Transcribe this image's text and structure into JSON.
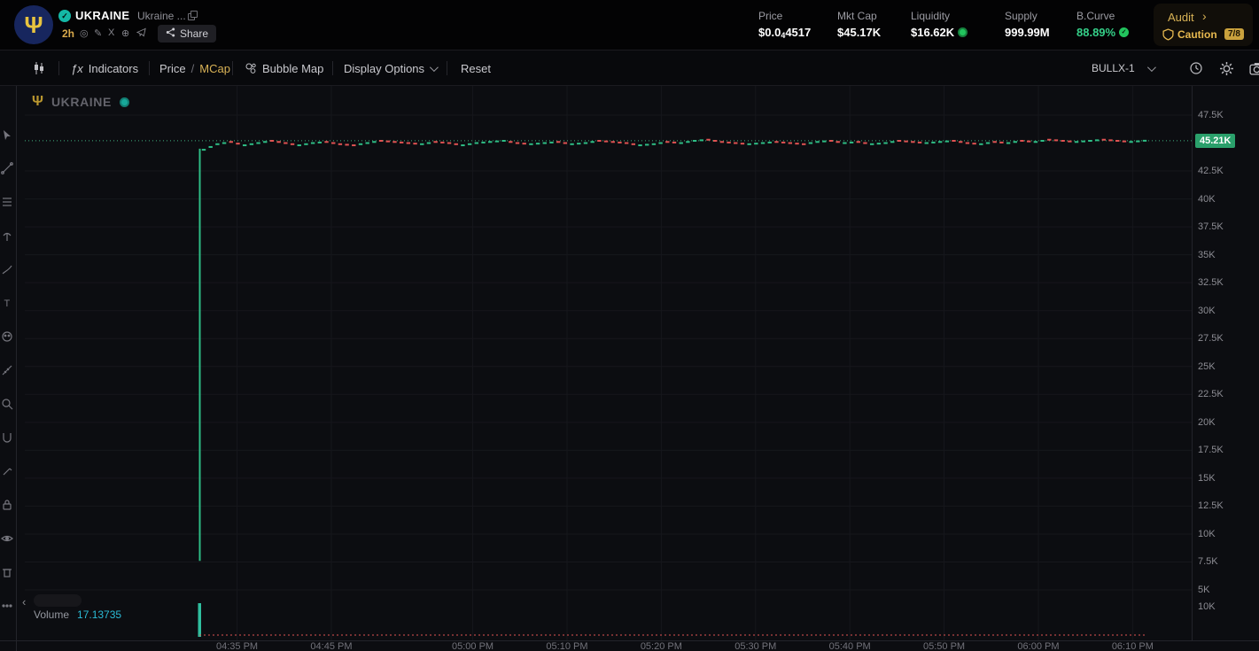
{
  "header": {
    "token": {
      "symbol": "UKRAINE",
      "name": "Ukraine ...",
      "age": "2h",
      "share_label": "Share"
    },
    "stats": {
      "price": {
        "label": "Price",
        "prefix": "$0.0",
        "subscript": "4",
        "suffix": "4517"
      },
      "mkt_cap": {
        "label": "Mkt Cap",
        "value": "$45.17K"
      },
      "liquidity": {
        "label": "Liquidity",
        "value": "$16.62K"
      },
      "supply": {
        "label": "Supply",
        "value": "999.99M"
      },
      "bcurve": {
        "label": "B.Curve",
        "value": "88.89%"
      }
    },
    "audit": {
      "label": "Audit",
      "status": "Caution",
      "score": "7/8"
    }
  },
  "toolbar": {
    "indicators_label": "Indicators",
    "price_label": "Price",
    "separator": "/",
    "mcap_label": "MCap",
    "bubble_map_label": "Bubble Map",
    "display_options_label": "Display Options",
    "reset_label": "Reset",
    "layout_label": "BULLX-1"
  },
  "sidebar": {
    "tools": [
      "cursor",
      "trend-line",
      "fib-retracement",
      "pitchfork",
      "brush",
      "text",
      "emoji",
      "measure",
      "zoom",
      "magnet",
      "edit",
      "lock",
      "eye",
      "remove",
      "more"
    ]
  },
  "chart": {
    "watermark_symbol": "UKRAINE",
    "volume_label": "Volume",
    "volume_value": "17.13735",
    "price_badge": "45.21K",
    "volume_axis_label": "10K"
  },
  "icons": {
    "logo_trident": "Ψ",
    "watermark_trident": "Ψ",
    "verified_check": "✓",
    "pump": "◎",
    "edit": "✎",
    "x_social": "X",
    "globe": "⊕",
    "audit_chevron": "›",
    "collapse": "‹",
    "fx": "ƒx"
  },
  "colors": {
    "up": "#2ebd85",
    "down": "#e05252",
    "grid": "#16171c",
    "divider": "#23242a",
    "gold": "#d8b256",
    "teal_bar": "#2fbf9f",
    "badge_green": "#2aa06b",
    "dotted_price": "#3fae7f"
  },
  "chart_data": {
    "type": "candlestick",
    "title": "UKRAINE market cap chart (2h old token)",
    "metric": "MCap (USD)",
    "current_price": 45210,
    "current_price_label": "45.21K",
    "series_start_time": "04:31 PM",
    "series_end_time": "06:11 PM",
    "x_ticks": [
      "04:35 PM",
      "04:45 PM",
      "05:00 PM",
      "05:10 PM",
      "05:20 PM",
      "05:30 PM",
      "05:40 PM",
      "05:50 PM",
      "06:00 PM",
      "06:10 PM"
    ],
    "y_ticks": [
      {
        "value": 47500,
        "label": "47.5K"
      },
      {
        "value": 42500,
        "label": "42.5K"
      },
      {
        "value": 40000,
        "label": "40K"
      },
      {
        "value": 37500,
        "label": "37.5K"
      },
      {
        "value": 35000,
        "label": "35K"
      },
      {
        "value": 32500,
        "label": "32.5K"
      },
      {
        "value": 30000,
        "label": "30K"
      },
      {
        "value": 27500,
        "label": "27.5K"
      },
      {
        "value": 25000,
        "label": "25K"
      },
      {
        "value": 22500,
        "label": "22.5K"
      },
      {
        "value": 20000,
        "label": "20K"
      },
      {
        "value": 17500,
        "label": "17.5K"
      },
      {
        "value": 15000,
        "label": "15K"
      },
      {
        "value": 12500,
        "label": "12.5K"
      },
      {
        "value": 10000,
        "label": "10K"
      },
      {
        "value": 7500,
        "label": "7.5K"
      },
      {
        "value": 5000,
        "label": "5K"
      }
    ],
    "ylim": [
      5000,
      47500
    ],
    "initial_candle": {
      "time": "04:31 PM",
      "open": 7600,
      "high": 44500,
      "low": 7600,
      "close": 44300,
      "direction": "up"
    },
    "closes_k": [
      44.4,
      44.9,
      45.1,
      44.8,
      45.0,
      45.2,
      45.0,
      44.8,
      45.0,
      45.1,
      44.9,
      44.8,
      45.0,
      45.2,
      45.1,
      45.0,
      44.9,
      45.1,
      45.0,
      44.8,
      45.0,
      45.1,
      45.2,
      45.0,
      44.9,
      45.0,
      45.1,
      44.9,
      45.0,
      45.2,
      45.1,
      45.0,
      44.8,
      44.9,
      45.1,
      45.0,
      45.2,
      45.3,
      45.1,
      45.0,
      44.9,
      45.0,
      45.1,
      45.0,
      44.9,
      45.1,
      45.2,
      45.0,
      45.1,
      44.9,
      45.0,
      45.2,
      45.1,
      45.0,
      45.1,
      45.2,
      45.0,
      44.9,
      45.1,
      45.0,
      45.2,
      45.1,
      45.3,
      45.2,
      45.1,
      45.2,
      45.3,
      45.2,
      45.1,
      45.21
    ],
    "volume": {
      "current": 17.13735,
      "axis_tick": "10K",
      "spike_time": "04:31 PM"
    }
  }
}
